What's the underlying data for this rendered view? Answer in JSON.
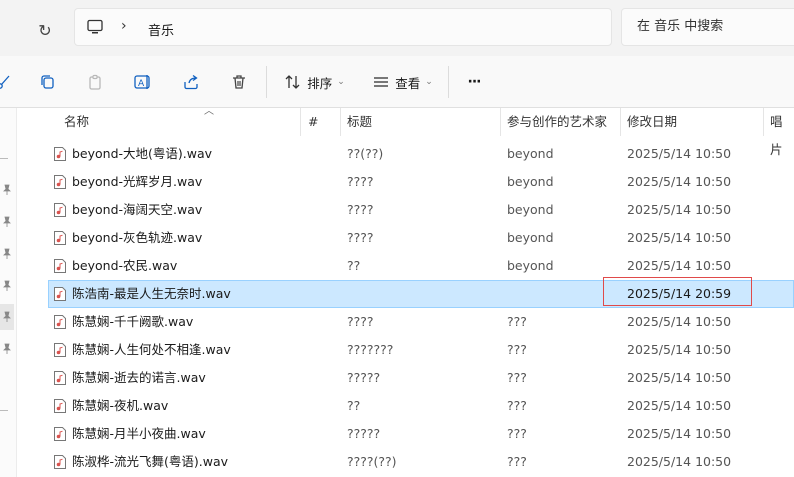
{
  "address": {
    "location": "音乐",
    "search_placeholder": "在 音乐 中搜索"
  },
  "toolbar": {
    "sort_label": "排序",
    "view_label": "查看",
    "more_label": "···"
  },
  "columns": {
    "name": "名称",
    "number": "#",
    "title": "标题",
    "artist": "参与创作的艺术家",
    "modified": "修改日期",
    "album": "唱片"
  },
  "files": [
    {
      "name": "beyond-大地(粤语).wav",
      "title": "??(??)",
      "artist": "beyond",
      "date": "2025/5/14 10:50"
    },
    {
      "name": "beyond-光辉岁月.wav",
      "title": "????",
      "artist": "beyond",
      "date": "2025/5/14 10:50"
    },
    {
      "name": "beyond-海阔天空.wav",
      "title": "????",
      "artist": "beyond",
      "date": "2025/5/14 10:50"
    },
    {
      "name": "beyond-灰色轨迹.wav",
      "title": "????",
      "artist": "beyond",
      "date": "2025/5/14 10:50"
    },
    {
      "name": "beyond-农民.wav",
      "title": "??",
      "artist": "beyond",
      "date": "2025/5/14 10:50"
    },
    {
      "name": "陈浩南-最是人生无奈时.wav",
      "title": "",
      "artist": "",
      "date": "2025/5/14 20:59",
      "selected": true
    },
    {
      "name": "陈慧娴-千千阙歌.wav",
      "title": "????",
      "artist": "???",
      "date": "2025/5/14 10:50"
    },
    {
      "name": "陈慧娴-人生何处不相逢.wav",
      "title": "???????",
      "artist": "???",
      "date": "2025/5/14 10:50"
    },
    {
      "name": "陈慧娴-逝去的诺言.wav",
      "title": "?????",
      "artist": "???",
      "date": "2025/5/14 10:50"
    },
    {
      "name": "陈慧娴-夜机.wav",
      "title": "??",
      "artist": "???",
      "date": "2025/5/14 10:50"
    },
    {
      "name": "陈慧娴-月半小夜曲.wav",
      "title": "?????",
      "artist": "???",
      "date": "2025/5/14 10:50"
    },
    {
      "name": "陈淑桦-流光飞舞(粤语).wav",
      "title": "????(??)",
      "artist": "???",
      "date": "2025/5/14 10:50"
    }
  ],
  "colors": {
    "selection": "#cce8ff",
    "annotation_box": "#e04a4a"
  }
}
